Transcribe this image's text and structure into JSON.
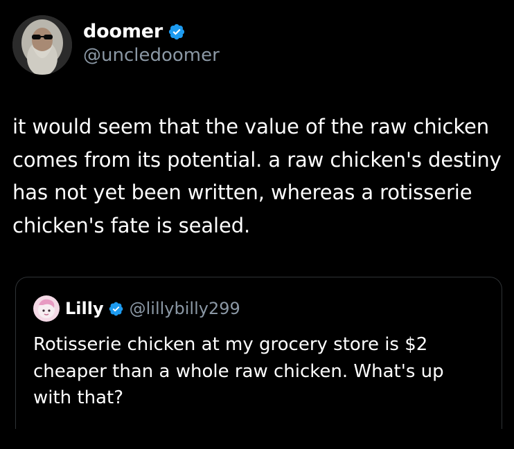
{
  "tweet": {
    "display_name": "doomer",
    "handle": "@uncledoomer",
    "verified_icon": "verified-badge-icon",
    "text": "it would seem that the value of the raw chicken comes from its potential. a raw chicken's destiny has not yet been written, whereas a rotisserie chicken's fate is sealed."
  },
  "quote": {
    "display_name": "Lilly",
    "handle": "@lillybilly299",
    "verified_icon": "verified-badge-icon",
    "text": "Rotisserie chicken at my grocery store is $2 cheaper than a whole raw chicken. What's up with that?"
  },
  "colors": {
    "background": "#000000",
    "text": "#ffffff",
    "secondary_text": "#8b98a5",
    "verified_blue": "#1d9bf0",
    "border": "#2f3336"
  }
}
